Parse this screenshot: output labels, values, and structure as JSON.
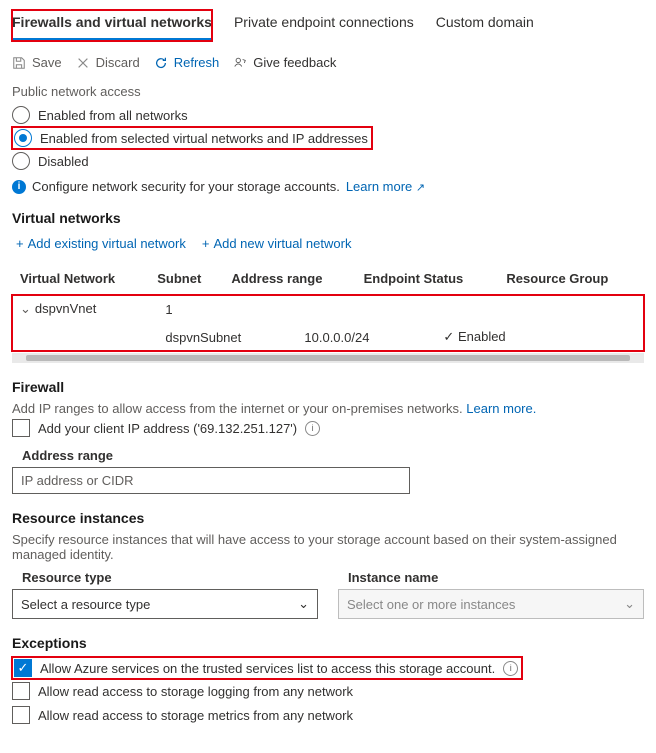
{
  "tabs": {
    "firewalls": "Firewalls and virtual networks",
    "endpoints": "Private endpoint connections",
    "domain": "Custom domain"
  },
  "toolbar": {
    "save": "Save",
    "discard": "Discard",
    "refresh": "Refresh",
    "feedback": "Give feedback"
  },
  "access": {
    "heading": "Public network access",
    "opt_all": "Enabled from all networks",
    "opt_selected": "Enabled from selected virtual networks and IP addresses",
    "opt_disabled": "Disabled",
    "info": "Configure network security for your storage accounts.",
    "learn": "Learn more"
  },
  "vnet": {
    "heading": "Virtual networks",
    "add_existing": "Add existing virtual network",
    "add_new": "Add new virtual network",
    "cols": {
      "vn": "Virtual Network",
      "sub": "Subnet",
      "range": "Address range",
      "status": "Endpoint Status",
      "rg": "Resource Group"
    },
    "row_vnet": "dspvnVnet",
    "row_subcount": "1",
    "row_subnet": "dspvnSubnet",
    "row_range": "10.0.0.0/24",
    "row_status": "Enabled"
  },
  "firewall": {
    "heading": "Firewall",
    "desc": "Add IP ranges to allow access from the internet or your on-premises networks.",
    "learn": "Learn more.",
    "add_client": "Add your client IP address ('69.132.251.127')",
    "addr_label": "Address range",
    "placeholder": "IP address or CIDR"
  },
  "ri": {
    "heading": "Resource instances",
    "desc": "Specify resource instances that will have access to your storage account based on their system-assigned managed identity.",
    "type_label": "Resource type",
    "name_label": "Instance name",
    "type_ph": "Select a resource type",
    "name_ph": "Select one or more instances"
  },
  "ex": {
    "heading": "Exceptions",
    "trusted": "Allow Azure services on the trusted services list to access this storage account.",
    "log": "Allow read access to storage logging from any network",
    "metrics": "Allow read access to storage metrics from any network"
  }
}
